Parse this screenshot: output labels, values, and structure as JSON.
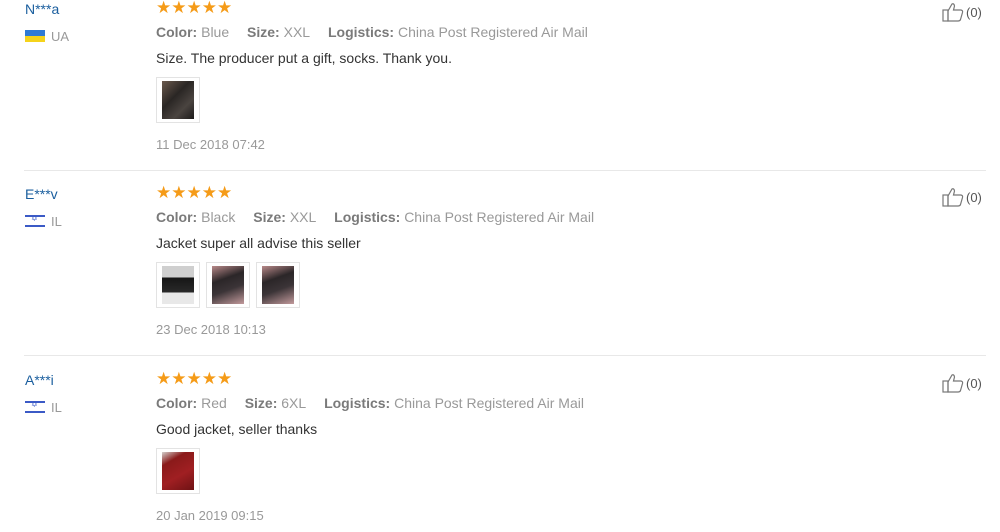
{
  "labels": {
    "color": "Color:",
    "size": "Size:",
    "logistics": "Logistics:"
  },
  "reviews": [
    {
      "buyer": "N***a",
      "country_code": "UA",
      "flag": "ukraine-flag",
      "rating": 5,
      "stars": "★★★★★",
      "color": "Blue",
      "size": "XXL",
      "logistics": "China Post Registered Air Mail",
      "text": "Size. The producer put a gift, socks. Thank you.",
      "photos": [
        "dark-jacket-photo"
      ],
      "date": "11 Dec 2018 07:42",
      "helpful": "(0)"
    },
    {
      "buyer": "E***v",
      "country_code": "IL",
      "flag": "israel-flag",
      "rating": 5,
      "stars": "★★★★★",
      "color": "Black",
      "size": "XXL",
      "logistics": "China Post Registered Air Mail",
      "text": "Jacket super all advise this seller",
      "photos": [
        "black-white-jacket-photo",
        "jacket-photo",
        "jacket-photo"
      ],
      "date": "23 Dec 2018 10:13",
      "helpful": "(0)"
    },
    {
      "buyer": "A***i",
      "country_code": "IL",
      "flag": "israel-flag",
      "rating": 5,
      "stars": "★★★★★",
      "color": "Red",
      "size": "6XL",
      "logistics": "China Post Registered Air Mail",
      "text": "Good jacket, seller thanks",
      "photos": [
        "red-jacket-photo"
      ],
      "date": "20 Jan 2019 09:15",
      "helpful": "(0)"
    }
  ],
  "colors": {
    "buyer_link": "#1a5e9e",
    "star": "#f59b18",
    "meta_text": "#999999"
  }
}
